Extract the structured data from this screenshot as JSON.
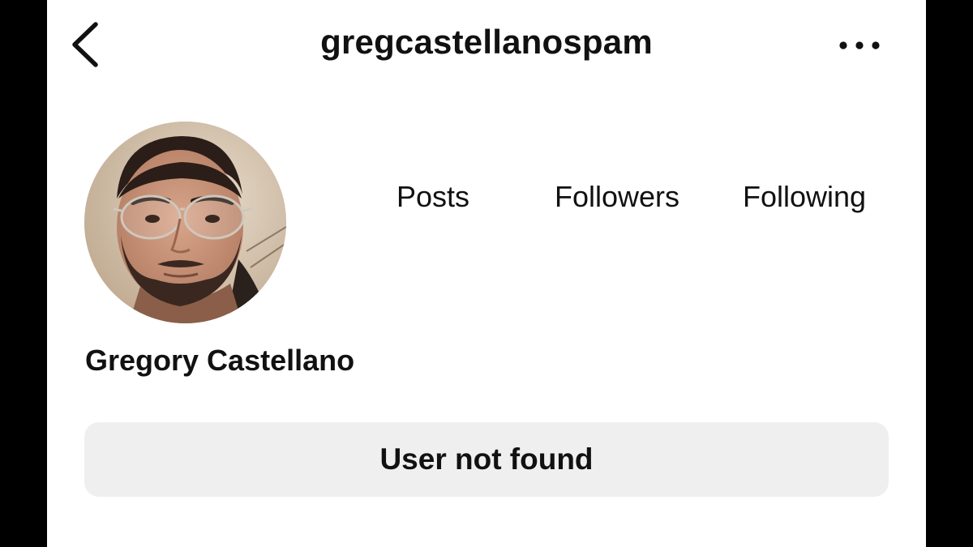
{
  "header": {
    "username": "gregcastellanospam",
    "back_icon": "chevron-left-icon",
    "more_icon": "more-horizontal-icon"
  },
  "profile": {
    "stats": {
      "posts_label": "Posts",
      "followers_label": "Followers",
      "following_label": "Following"
    },
    "display_name": "Gregory Castellano",
    "status_button_label": "User not found"
  },
  "colors": {
    "background": "#ffffff",
    "text": "#111111",
    "button_bg": "#efefef",
    "frame": "#000000"
  }
}
